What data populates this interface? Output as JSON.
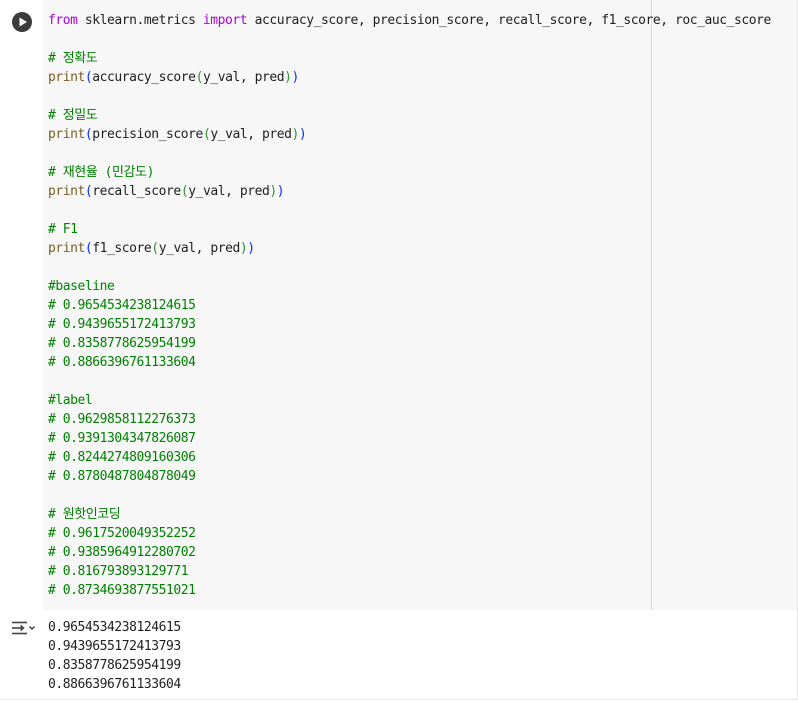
{
  "cell": {
    "run_icon": "play-circle-icon",
    "code_lines": {
      "l1": {
        "kw1": "from",
        "mid": " sklearn.metrics ",
        "kw2": "import",
        "rest": " accuracy_score, precision_score, recall_score, f1_score, roc_auc_score"
      },
      "l3": "# 정확도",
      "l4": {
        "fn": "print",
        "inner": "accuracy_score",
        "args": "y_val, pred"
      },
      "l6": "# 정밀도",
      "l7": {
        "fn": "print",
        "inner": "precision_score",
        "args": "y_val, pred"
      },
      "l9": "# 재현율 (민감도)",
      "l10": {
        "fn": "print",
        "inner": "recall_score",
        "args": "y_val, pred"
      },
      "l12": "# F1",
      "l13": {
        "fn": "print",
        "inner": "f1_score",
        "args": "y_val, pred"
      },
      "l15": "#baseline",
      "l16": "# 0.9654534238124615",
      "l17": "# 0.9439655172413793",
      "l18": "# 0.8358778625954199",
      "l19": "# 0.8866396761133604",
      "l21": "#label",
      "l22": "# 0.9629858112276373",
      "l23": "# 0.9391304347826087",
      "l24": "# 0.8244274809160306",
      "l25": "# 0.8780487804878049",
      "l27": "# 원핫인코딩",
      "l28": "# 0.9617520049352252",
      "l29": "# 0.9385964912280702",
      "l30": "# 0.816793893129771",
      "l31": "# 0.8734693877551021"
    }
  },
  "output": {
    "toggle_icon": "output-collapse-icon",
    "lines": [
      "0.9654534238124615",
      "0.9439655172413793",
      "0.8358778625954199",
      "0.8866396761133604"
    ]
  },
  "colors": {
    "keyword": "#af00db",
    "function": "#795e26",
    "paren_outer": "#0431fa",
    "paren_inner": "#319331",
    "comment": "#008000",
    "editor_bg": "#f7f7f7"
  }
}
